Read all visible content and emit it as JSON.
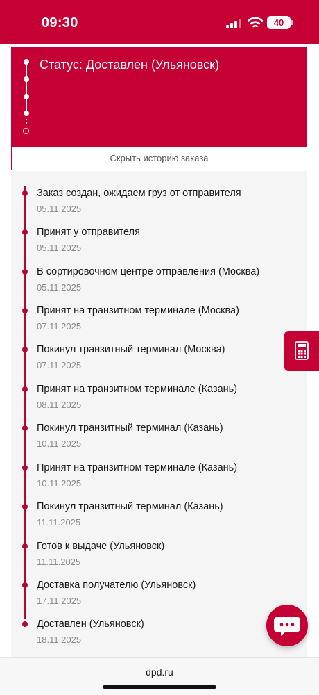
{
  "status_bar": {
    "time": "09:30",
    "battery": "40",
    "icons": [
      "cellular-signal-icon",
      "wifi-icon",
      "battery-icon"
    ]
  },
  "status_card": {
    "title": "Статус: Доставлен (Ульяновск)",
    "hide_history_label": "Скрыть историю заказа"
  },
  "history": [
    {
      "title": "Заказ создан, ожидаем груз от отправителя",
      "date": "05.11.2025"
    },
    {
      "title": "Принят у отправителя",
      "date": "05.11.2025"
    },
    {
      "title": "В сортировочном центре отправления (Москва)",
      "date": "05.11.2025"
    },
    {
      "title": "Принят на транзитном терминале (Москва)",
      "date": "07.11.2025"
    },
    {
      "title": "Покинул транзитный терминал (Москва)",
      "date": "07.11.2025"
    },
    {
      "title": "Принят на транзитном терминале (Казань)",
      "date": "08.11.2025"
    },
    {
      "title": "Покинул транзитный терминал (Казань)",
      "date": "10.11.2025"
    },
    {
      "title": "Принят на транзитном терминале (Казань)",
      "date": "10.11.2025"
    },
    {
      "title": "Покинул транзитный терминал (Казань)",
      "date": "11.11.2025"
    },
    {
      "title": "Готов к выдаче (Ульяновск)",
      "date": "11.11.2025"
    },
    {
      "title": "Доставка получателю (Ульяновск)",
      "date": "17.11.2025"
    },
    {
      "title": "Доставлен (Ульяновск)",
      "date": "18.11.2025"
    }
  ],
  "footer": {
    "url": "dpd.ru"
  },
  "colors": {
    "brand": "#c40035",
    "timeline": "#b00734",
    "panel_bg": "#f5f5f5"
  }
}
